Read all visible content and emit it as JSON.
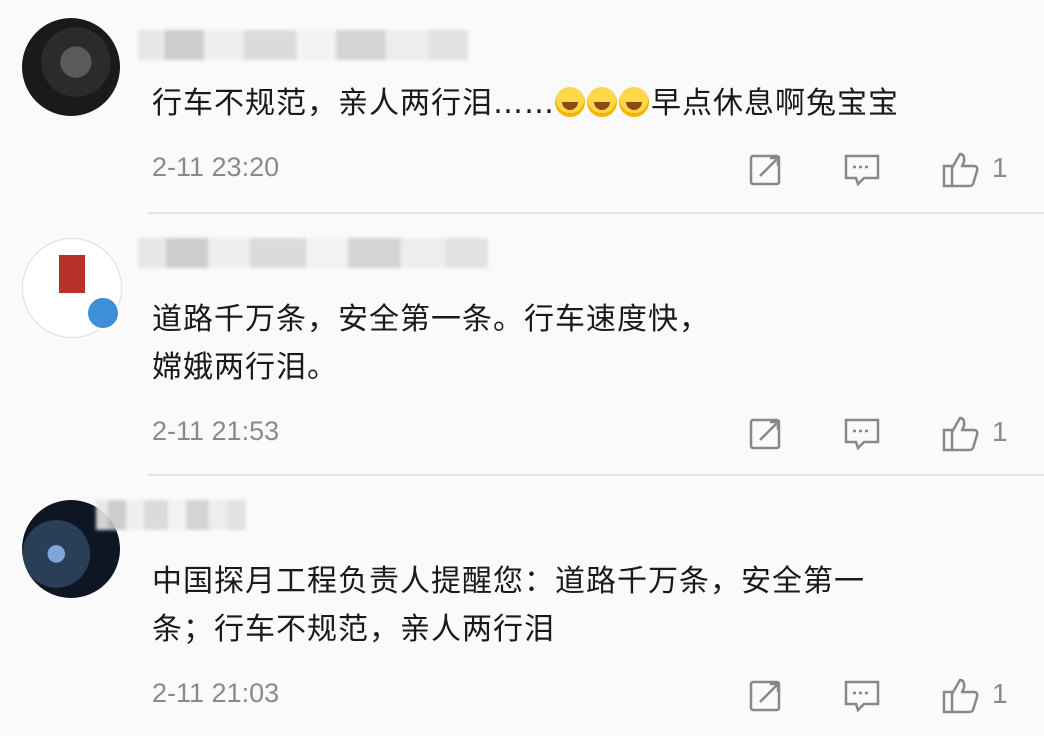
{
  "comments": [
    {
      "text_before_emoji": "行车不规范，亲人两行泪……",
      "emojis": [
        "laughing-crying-emoji",
        "laughing-crying-emoji",
        "laughing-crying-emoji"
      ],
      "text_after_emoji": "早点休息啊兔宝宝",
      "time": "2-11 23:20",
      "likes": "1"
    },
    {
      "text_line1": "道路千万条，安全第一条。行车速度快，",
      "text_line2": "嫦娥两行泪。",
      "time": "2-11 21:53",
      "likes": "1"
    },
    {
      "text_line1": "中国探月工程负责人提醒您：道路千万条，安全第一",
      "text_line2": "条；行车不规范，亲人两行泪",
      "time": "2-11 21:03",
      "likes": "1"
    }
  ],
  "icons": {
    "share": "share-icon",
    "reply": "reply-icon",
    "like": "thumbs-up-icon",
    "verified": "verified-badge-icon"
  },
  "colors": {
    "text": "#1a1a1a",
    "meta": "#8a8a8a",
    "verified": "#3d8fd8"
  }
}
